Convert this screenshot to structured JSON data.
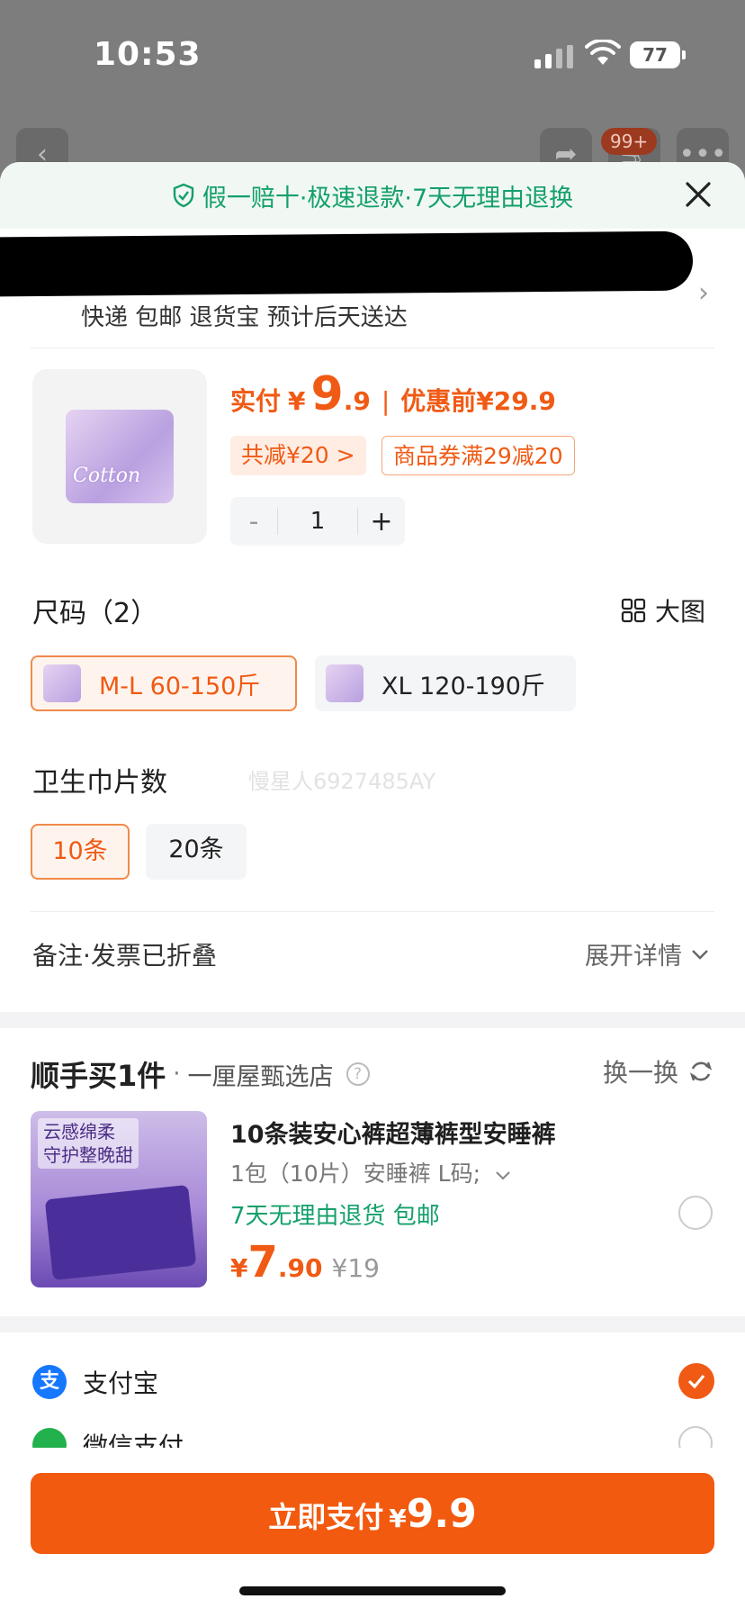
{
  "status_bar": {
    "time": "10:53",
    "battery": "77"
  },
  "top_badges": {
    "cart_count": "99+"
  },
  "guarantee": {
    "text": "假一赔十·极速退款·7天无理由退换"
  },
  "delivery": {
    "text": "快递 包邮 退货宝 预计后天送达"
  },
  "product": {
    "price_label": "实付",
    "yen": "¥",
    "price_int": "9",
    "price_dec": ".9",
    "separator": "|",
    "price_before": "优惠前¥29.9",
    "discount_tag": "共减¥20 >",
    "coupon_tag": "商品券满29减20",
    "quantity": "1",
    "minus": "-",
    "plus": "+",
    "pack_text": "Cotton"
  },
  "size": {
    "title": "尺码（2）",
    "big_view": "大图",
    "options": [
      "M-L 60-150斤",
      "XL 120-190斤"
    ]
  },
  "count": {
    "title": "卫生巾片数",
    "options": [
      "10条",
      "20条"
    ]
  },
  "watermark": "慢星人6927485AY",
  "note": {
    "label": "备注·发票已折叠",
    "expand": "展开详情"
  },
  "recommend": {
    "brand": "顺手买1件",
    "dot": "·",
    "shop": "一厘屋甄选店",
    "question": "?",
    "swap": "换一换",
    "image_caption": "云感绵柔\n守护整晚甜",
    "title": "10条装安心裤超薄裤型安睡裤",
    "spec": "1包（10片）安睡裤 L码;",
    "perks": "7天无理由退货 包邮",
    "yen": "¥",
    "price": "7",
    "price_dec": ".90",
    "orig_price": "¥19"
  },
  "payment": {
    "alipay": "支付宝",
    "alipay_icon": "支",
    "wechat": "微信支付"
  },
  "pay_button": {
    "label": "立即支付",
    "yen": "¥",
    "amount": "9.9"
  }
}
